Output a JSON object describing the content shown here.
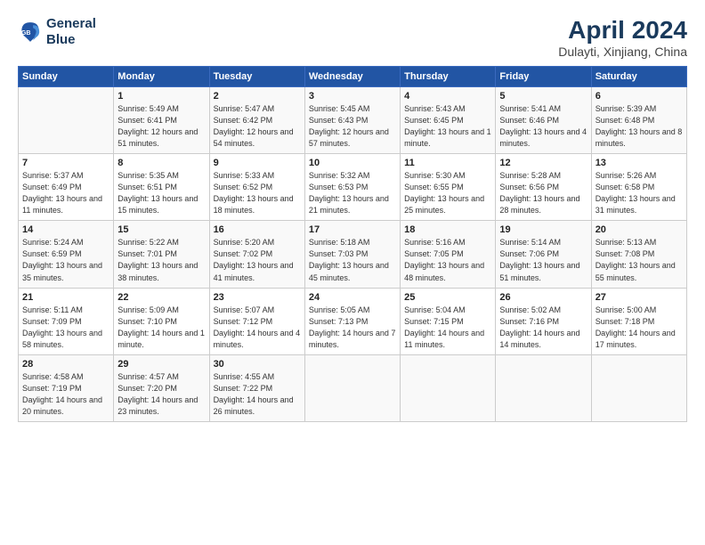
{
  "logo": {
    "line1": "General",
    "line2": "Blue"
  },
  "title": "April 2024",
  "subtitle": "Dulayti, Xinjiang, China",
  "header_color": "#2255a4",
  "days_of_week": [
    "Sunday",
    "Monday",
    "Tuesday",
    "Wednesday",
    "Thursday",
    "Friday",
    "Saturday"
  ],
  "weeks": [
    [
      {
        "num": "",
        "sunrise": "",
        "sunset": "",
        "daylight": ""
      },
      {
        "num": "1",
        "sunrise": "Sunrise: 5:49 AM",
        "sunset": "Sunset: 6:41 PM",
        "daylight": "Daylight: 12 hours and 51 minutes."
      },
      {
        "num": "2",
        "sunrise": "Sunrise: 5:47 AM",
        "sunset": "Sunset: 6:42 PM",
        "daylight": "Daylight: 12 hours and 54 minutes."
      },
      {
        "num": "3",
        "sunrise": "Sunrise: 5:45 AM",
        "sunset": "Sunset: 6:43 PM",
        "daylight": "Daylight: 12 hours and 57 minutes."
      },
      {
        "num": "4",
        "sunrise": "Sunrise: 5:43 AM",
        "sunset": "Sunset: 6:45 PM",
        "daylight": "Daylight: 13 hours and 1 minute."
      },
      {
        "num": "5",
        "sunrise": "Sunrise: 5:41 AM",
        "sunset": "Sunset: 6:46 PM",
        "daylight": "Daylight: 13 hours and 4 minutes."
      },
      {
        "num": "6",
        "sunrise": "Sunrise: 5:39 AM",
        "sunset": "Sunset: 6:48 PM",
        "daylight": "Daylight: 13 hours and 8 minutes."
      }
    ],
    [
      {
        "num": "7",
        "sunrise": "Sunrise: 5:37 AM",
        "sunset": "Sunset: 6:49 PM",
        "daylight": "Daylight: 13 hours and 11 minutes."
      },
      {
        "num": "8",
        "sunrise": "Sunrise: 5:35 AM",
        "sunset": "Sunset: 6:51 PM",
        "daylight": "Daylight: 13 hours and 15 minutes."
      },
      {
        "num": "9",
        "sunrise": "Sunrise: 5:33 AM",
        "sunset": "Sunset: 6:52 PM",
        "daylight": "Daylight: 13 hours and 18 minutes."
      },
      {
        "num": "10",
        "sunrise": "Sunrise: 5:32 AM",
        "sunset": "Sunset: 6:53 PM",
        "daylight": "Daylight: 13 hours and 21 minutes."
      },
      {
        "num": "11",
        "sunrise": "Sunrise: 5:30 AM",
        "sunset": "Sunset: 6:55 PM",
        "daylight": "Daylight: 13 hours and 25 minutes."
      },
      {
        "num": "12",
        "sunrise": "Sunrise: 5:28 AM",
        "sunset": "Sunset: 6:56 PM",
        "daylight": "Daylight: 13 hours and 28 minutes."
      },
      {
        "num": "13",
        "sunrise": "Sunrise: 5:26 AM",
        "sunset": "Sunset: 6:58 PM",
        "daylight": "Daylight: 13 hours and 31 minutes."
      }
    ],
    [
      {
        "num": "14",
        "sunrise": "Sunrise: 5:24 AM",
        "sunset": "Sunset: 6:59 PM",
        "daylight": "Daylight: 13 hours and 35 minutes."
      },
      {
        "num": "15",
        "sunrise": "Sunrise: 5:22 AM",
        "sunset": "Sunset: 7:01 PM",
        "daylight": "Daylight: 13 hours and 38 minutes."
      },
      {
        "num": "16",
        "sunrise": "Sunrise: 5:20 AM",
        "sunset": "Sunset: 7:02 PM",
        "daylight": "Daylight: 13 hours and 41 minutes."
      },
      {
        "num": "17",
        "sunrise": "Sunrise: 5:18 AM",
        "sunset": "Sunset: 7:03 PM",
        "daylight": "Daylight: 13 hours and 45 minutes."
      },
      {
        "num": "18",
        "sunrise": "Sunrise: 5:16 AM",
        "sunset": "Sunset: 7:05 PM",
        "daylight": "Daylight: 13 hours and 48 minutes."
      },
      {
        "num": "19",
        "sunrise": "Sunrise: 5:14 AM",
        "sunset": "Sunset: 7:06 PM",
        "daylight": "Daylight: 13 hours and 51 minutes."
      },
      {
        "num": "20",
        "sunrise": "Sunrise: 5:13 AM",
        "sunset": "Sunset: 7:08 PM",
        "daylight": "Daylight: 13 hours and 55 minutes."
      }
    ],
    [
      {
        "num": "21",
        "sunrise": "Sunrise: 5:11 AM",
        "sunset": "Sunset: 7:09 PM",
        "daylight": "Daylight: 13 hours and 58 minutes."
      },
      {
        "num": "22",
        "sunrise": "Sunrise: 5:09 AM",
        "sunset": "Sunset: 7:10 PM",
        "daylight": "Daylight: 14 hours and 1 minute."
      },
      {
        "num": "23",
        "sunrise": "Sunrise: 5:07 AM",
        "sunset": "Sunset: 7:12 PM",
        "daylight": "Daylight: 14 hours and 4 minutes."
      },
      {
        "num": "24",
        "sunrise": "Sunrise: 5:05 AM",
        "sunset": "Sunset: 7:13 PM",
        "daylight": "Daylight: 14 hours and 7 minutes."
      },
      {
        "num": "25",
        "sunrise": "Sunrise: 5:04 AM",
        "sunset": "Sunset: 7:15 PM",
        "daylight": "Daylight: 14 hours and 11 minutes."
      },
      {
        "num": "26",
        "sunrise": "Sunrise: 5:02 AM",
        "sunset": "Sunset: 7:16 PM",
        "daylight": "Daylight: 14 hours and 14 minutes."
      },
      {
        "num": "27",
        "sunrise": "Sunrise: 5:00 AM",
        "sunset": "Sunset: 7:18 PM",
        "daylight": "Daylight: 14 hours and 17 minutes."
      }
    ],
    [
      {
        "num": "28",
        "sunrise": "Sunrise: 4:58 AM",
        "sunset": "Sunset: 7:19 PM",
        "daylight": "Daylight: 14 hours and 20 minutes."
      },
      {
        "num": "29",
        "sunrise": "Sunrise: 4:57 AM",
        "sunset": "Sunset: 7:20 PM",
        "daylight": "Daylight: 14 hours and 23 minutes."
      },
      {
        "num": "30",
        "sunrise": "Sunrise: 4:55 AM",
        "sunset": "Sunset: 7:22 PM",
        "daylight": "Daylight: 14 hours and 26 minutes."
      },
      {
        "num": "",
        "sunrise": "",
        "sunset": "",
        "daylight": ""
      },
      {
        "num": "",
        "sunrise": "",
        "sunset": "",
        "daylight": ""
      },
      {
        "num": "",
        "sunrise": "",
        "sunset": "",
        "daylight": ""
      },
      {
        "num": "",
        "sunrise": "",
        "sunset": "",
        "daylight": ""
      }
    ]
  ]
}
